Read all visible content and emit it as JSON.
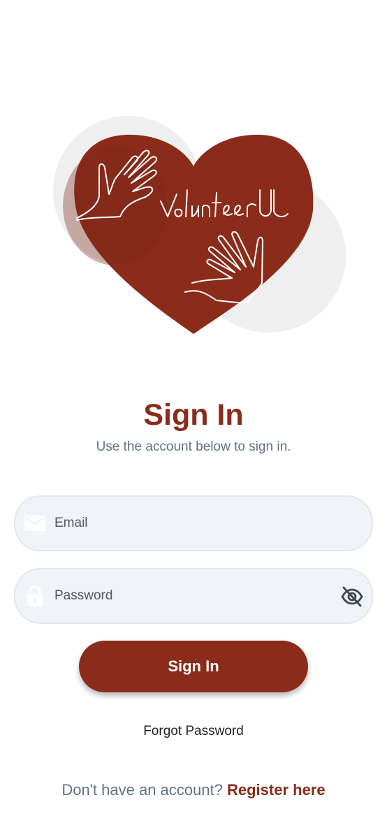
{
  "app": {
    "logo_name": "VolunteerU",
    "brand_color": "#8b2c1b"
  },
  "header": {
    "title": "Sign In",
    "subtitle": "Use the account below to sign in."
  },
  "form": {
    "email": {
      "value": "",
      "placeholder": "Email",
      "icon": "mail-icon"
    },
    "password": {
      "value": "",
      "placeholder": "Password",
      "icon": "lock-icon",
      "toggle_icon": "eye-off-icon"
    },
    "submit_label": "Sign In"
  },
  "links": {
    "forgot_password": "Forgot Password",
    "register_prompt": "Don't have an account?",
    "register_link": "Register here"
  }
}
